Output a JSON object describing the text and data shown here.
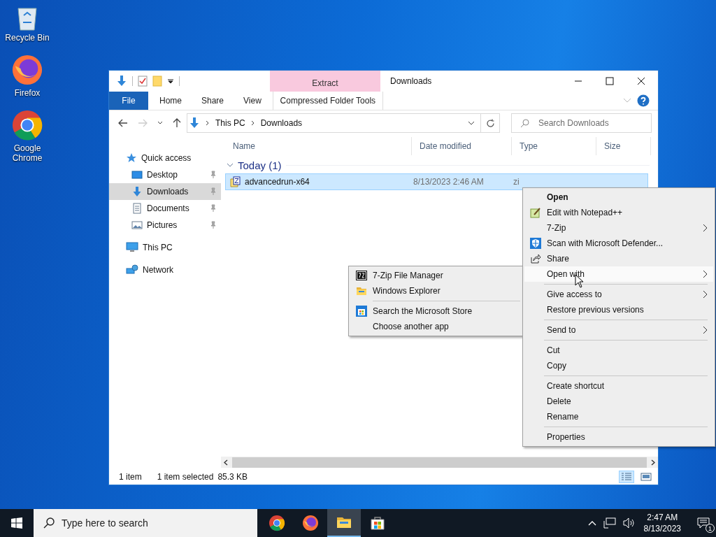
{
  "desktop_icons": [
    {
      "label": "Recycle Bin",
      "kind": "recycle"
    },
    {
      "label": "Firefox",
      "kind": "firefox"
    },
    {
      "label": "Google Chrome",
      "kind": "chrome"
    }
  ],
  "window": {
    "title": "Downloads",
    "context_group": "Extract",
    "tabs": [
      {
        "label": "File",
        "kind": "file"
      },
      {
        "label": "Home",
        "kind": "plain"
      },
      {
        "label": "Share",
        "kind": "plain"
      },
      {
        "label": "View",
        "kind": "plain"
      },
      {
        "label": "Compressed Folder Tools",
        "kind": "contextual"
      }
    ],
    "address": [
      "This PC",
      "Downloads"
    ],
    "search": {
      "placeholder": "Search Downloads"
    },
    "nav": [
      {
        "label": "Quick access",
        "kind": "star",
        "selected": false,
        "children": [
          {
            "label": "Desktop",
            "kind": "desktop",
            "selected": false,
            "pinned": true
          },
          {
            "label": "Downloads",
            "kind": "download",
            "selected": true,
            "pinned": true
          },
          {
            "label": "Documents",
            "kind": "document",
            "selected": false,
            "pinned": true
          },
          {
            "label": "Pictures",
            "kind": "pictures",
            "selected": false,
            "pinned": true
          }
        ]
      },
      {
        "label": "This PC",
        "kind": "pc",
        "selected": false
      },
      {
        "label": "Network",
        "kind": "network",
        "selected": false
      }
    ],
    "columns": [
      "Name",
      "Date modified",
      "Type",
      "Size"
    ],
    "group": {
      "label": "Today (1)",
      "expanded": true
    },
    "files": [
      {
        "name": "advancedrun-x64",
        "date": "8/13/2023 2:46 AM",
        "type": "zi",
        "selected": true
      }
    ],
    "status": {
      "count": "1 item",
      "selection": "1 item selected",
      "size": "85.3 KB"
    }
  },
  "context_menu": {
    "groups": [
      [
        {
          "label": "Open",
          "kind": "plain",
          "default": true,
          "submenu": false,
          "highlighted": false
        },
        {
          "label": "Edit with Notepad++",
          "kind": "notepad",
          "default": false,
          "submenu": false,
          "highlighted": false
        },
        {
          "label": "7-Zip",
          "kind": "plain",
          "default": false,
          "submenu": true,
          "highlighted": false
        },
        {
          "label": "Scan with Microsoft Defender...",
          "kind": "defender",
          "default": false,
          "submenu": false,
          "highlighted": false
        },
        {
          "label": "Share",
          "kind": "share",
          "default": false,
          "submenu": false,
          "highlighted": false
        },
        {
          "label": "Open with",
          "kind": "plain",
          "default": false,
          "submenu": true,
          "highlighted": true
        }
      ],
      [
        {
          "label": "Give access to",
          "kind": "plain",
          "default": false,
          "submenu": true,
          "highlighted": false
        },
        {
          "label": "Restore previous versions",
          "kind": "plain",
          "default": false,
          "submenu": false,
          "highlighted": false
        }
      ],
      [
        {
          "label": "Send to",
          "kind": "plain",
          "default": false,
          "submenu": true,
          "highlighted": false
        }
      ],
      [
        {
          "label": "Cut",
          "kind": "plain",
          "default": false,
          "submenu": false,
          "highlighted": false
        },
        {
          "label": "Copy",
          "kind": "plain",
          "default": false,
          "submenu": false,
          "highlighted": false
        }
      ],
      [
        {
          "label": "Create shortcut",
          "kind": "plain",
          "default": false,
          "submenu": false,
          "highlighted": false
        },
        {
          "label": "Delete",
          "kind": "plain",
          "default": false,
          "submenu": false,
          "highlighted": false
        },
        {
          "label": "Rename",
          "kind": "plain",
          "default": false,
          "submenu": false,
          "highlighted": false
        }
      ],
      [
        {
          "label": "Properties",
          "kind": "plain",
          "default": false,
          "submenu": false,
          "highlighted": false
        }
      ]
    ]
  },
  "open_with_menu": {
    "groups": [
      [
        {
          "label": "7-Zip File Manager",
          "kind": "sevenzip"
        },
        {
          "label": "Windows Explorer",
          "kind": "explorer"
        }
      ],
      [
        {
          "label": "Search the Microsoft Store",
          "kind": "store"
        },
        {
          "label": "Choose another app",
          "kind": "plain"
        }
      ]
    ]
  },
  "taskbar": {
    "search": {
      "placeholder": "Type here to search"
    },
    "apps": [
      {
        "kind": "chrome",
        "active": false
      },
      {
        "kind": "firefox",
        "active": false
      },
      {
        "kind": "explorer",
        "active": true
      },
      {
        "kind": "store",
        "active": false
      }
    ],
    "time": "2:47 AM",
    "date": "8/13/2023",
    "notifications": "1"
  }
}
